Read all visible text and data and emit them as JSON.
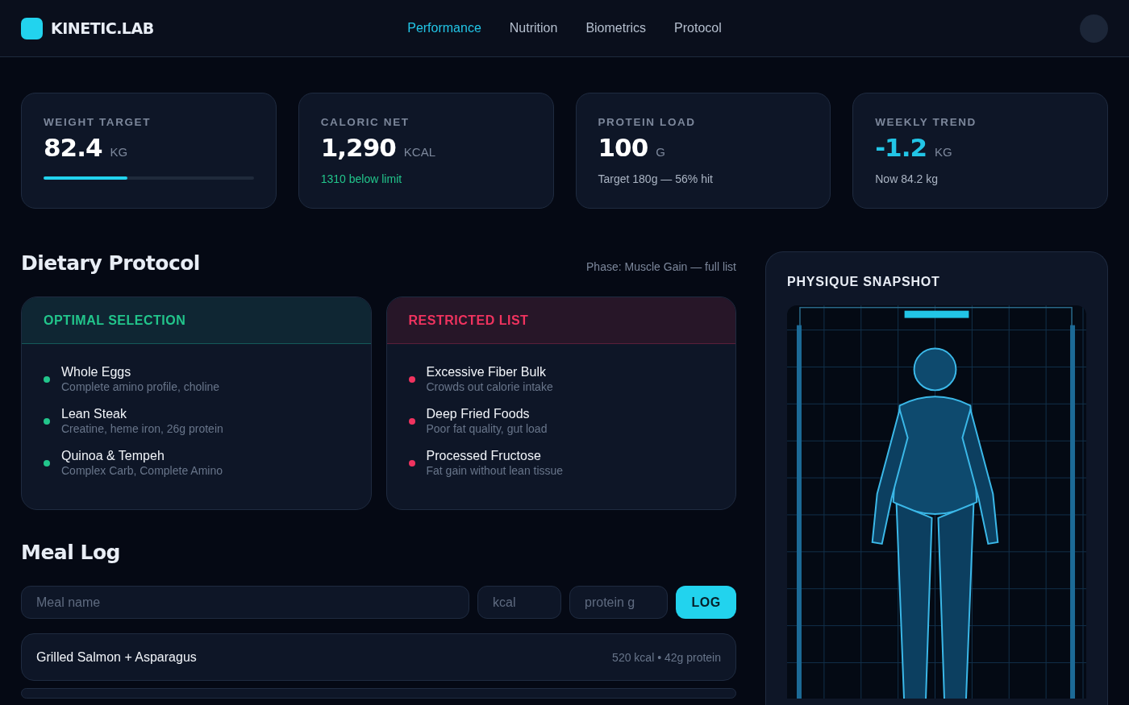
{
  "brand": {
    "name": "KINETIC.LAB"
  },
  "nav": [
    {
      "label": "Performance",
      "selected": true
    },
    {
      "label": "Nutrition",
      "selected": false
    },
    {
      "label": "Biometrics",
      "selected": false
    },
    {
      "label": "Protocol",
      "selected": false
    }
  ],
  "stats": [
    {
      "label": "WEIGHT TARGET",
      "value": "82.4",
      "unit": "KG",
      "accent": false,
      "kind": "bar",
      "level": 0.4
    },
    {
      "label": "CALORIC NET",
      "value": "1,290",
      "unit": "KCAL",
      "accent": false,
      "kind": "note",
      "note": "1310 below limit",
      "positive": true
    },
    {
      "label": "PROTEIN LOAD",
      "value": "100",
      "unit": "G",
      "accent": false,
      "kind": "note",
      "note": "Target 180g — 56% hit",
      "positive": false
    },
    {
      "label": "WEEKLY TREND",
      "value": "-1.2",
      "unit": "KG",
      "accent": true,
      "kind": "note",
      "note": "Now 84.2 kg",
      "positive": false
    }
  ],
  "dietary": {
    "title": "Dietary Protocol",
    "phase": "Phase: Muscle Gain — full list",
    "lists": [
      {
        "title": "OPTIMAL SELECTION",
        "kind": "optimal",
        "items": [
          {
            "name": "Whole Eggs",
            "detail": "Complete amino profile, choline"
          },
          {
            "name": "Lean Steak",
            "detail": "Creatine, heme iron, 26g protein"
          },
          {
            "name": "Quinoa & Tempeh",
            "detail": "Complex Carb, Complete Amino"
          }
        ]
      },
      {
        "title": "RESTRICTED LIST",
        "kind": "restricted",
        "items": [
          {
            "name": "Excessive Fiber Bulk",
            "detail": "Crowds out calorie intake"
          },
          {
            "name": "Deep Fried Foods",
            "detail": "Poor fat quality, gut load"
          },
          {
            "name": "Processed Fructose",
            "detail": "Fat gain without lean tissue"
          }
        ]
      }
    ]
  },
  "meal_log": {
    "title": "Meal Log",
    "fields": [
      {
        "placeholder": "Meal name",
        "kind": "wide"
      },
      {
        "placeholder": "kcal",
        "kind": "narrow"
      },
      {
        "placeholder": "protein g",
        "kind": "narrow"
      }
    ],
    "button": "LOG",
    "meals": [
      {
        "name": "Grilled Salmon + Asparagus",
        "stats": "520 kcal • 42g protein"
      }
    ]
  },
  "physique": {
    "title": "PHYSIQUE SNAPSHOT"
  }
}
